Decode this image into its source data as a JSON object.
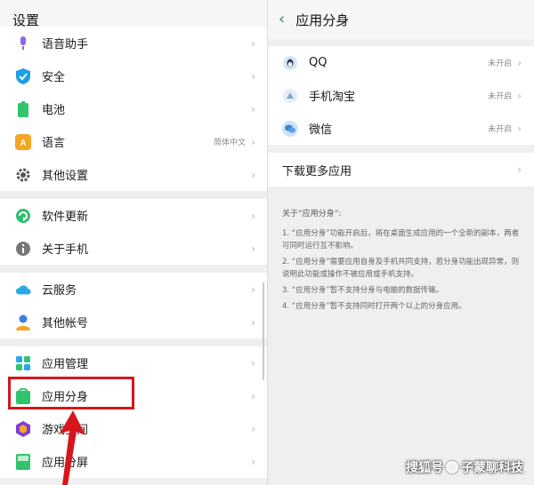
{
  "left": {
    "title": "设置",
    "groups": [
      [
        {
          "label": "语音助手",
          "icon": "mic-icon",
          "color": "#8a66e8"
        },
        {
          "label": "安全",
          "icon": "shield-icon",
          "color": "#1aa1e6"
        },
        {
          "label": "电池",
          "icon": "battery-icon",
          "color": "#2fc46d"
        },
        {
          "label": "语言",
          "icon": "language-icon",
          "color": "#f5a623",
          "value": "简体中文"
        },
        {
          "label": "其他设置",
          "icon": "gear-icon",
          "color": "#555555"
        }
      ],
      [
        {
          "label": "软件更新",
          "icon": "update-icon",
          "color": "#2fbf71"
        },
        {
          "label": "关于手机",
          "icon": "info-icon",
          "color": "#777777"
        }
      ],
      [
        {
          "label": "云服务",
          "icon": "cloud-icon",
          "color": "#29a9e8"
        },
        {
          "label": "其他帐号",
          "icon": "account-icon",
          "color": "#3b7fe0"
        }
      ],
      [
        {
          "label": "应用管理",
          "icon": "app-grid-icon",
          "color": "#2aa7e8"
        },
        {
          "label": "应用分身",
          "icon": "app-clone-icon",
          "color": "#2fc46d"
        },
        {
          "label": "游戏空间",
          "icon": "game-space-icon",
          "color": "#7b3fd6"
        },
        {
          "label": "应用分屏",
          "icon": "split-screen-icon",
          "color": "#2fc46d"
        }
      ]
    ]
  },
  "right": {
    "title": "应用分身",
    "apps": [
      {
        "label": "QQ",
        "status": "未开启",
        "icon": "qq-icon"
      },
      {
        "label": "手机淘宝",
        "status": "未开启",
        "icon": "taobao-icon"
      },
      {
        "label": "微信",
        "status": "未开启",
        "icon": "wechat-icon"
      }
    ],
    "download_more": "下载更多应用",
    "note_title": "关于“应用分身”:",
    "notes": [
      "1. “应用分身”功能开启后，将在桌面生成应用的一个全新的副本，两者可同时运行互不影响。",
      "2. “应用分身”需要应用自身及手机共同支持，若分身功能出现异常，则说明此功能或操作不被应用或手机支持。",
      "3. “应用分身”暂不支持分身与电脑的数据传输。",
      "4. “应用分身”暂不支持同时打开两个以上的分身应用。"
    ]
  },
  "watermark": {
    "prefix": "搜狐号",
    "suffix": "子蒙聊科技"
  },
  "colors": {
    "accent": "#2d8f66",
    "highlight": "#d6161b"
  }
}
